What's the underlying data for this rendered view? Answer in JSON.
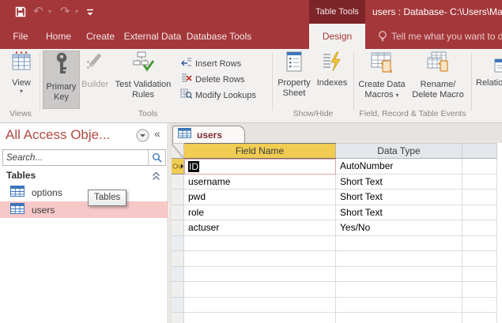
{
  "colors": {
    "accent": "#A4373A",
    "context_tab_bg": "#7D2429",
    "ribbon_bg": "#F3F1F0",
    "selected_column_header": "#F0CD52",
    "nav_selected_item": "#F6C8C8"
  },
  "titlebar": {
    "context_group": "Table Tools",
    "title": "users : Database- C:\\Users\\Mat"
  },
  "menu": {
    "tabs": [
      {
        "label": "File"
      },
      {
        "label": "Home"
      },
      {
        "label": "Create"
      },
      {
        "label": "External Data"
      },
      {
        "label": "Database Tools"
      },
      {
        "label": "Design"
      }
    ],
    "tell_me": "Tell me what you want to d"
  },
  "ribbon": {
    "views": {
      "label": "Views",
      "view": "View"
    },
    "tools": {
      "label": "Tools",
      "primary_key": "Primary Key",
      "builder": "Builder",
      "test_validation": "Test Validation Rules",
      "insert_rows": "Insert Rows",
      "delete_rows": "Delete Rows",
      "modify_lookups": "Modify Lookups"
    },
    "show_hide": {
      "label": "Show/Hide",
      "property_sheet": "Property Sheet",
      "indexes": "Indexes"
    },
    "events": {
      "label": "Field, Record & Table Events",
      "create_data_macros": "Create Data Macros",
      "rename_delete_macro": "Rename/ Delete Macro"
    },
    "relationships": {
      "label": "Relationships"
    }
  },
  "nav": {
    "title": "All Access Obje...",
    "search_placeholder": "Search...",
    "group_header": "Tables",
    "items": [
      {
        "label": "options"
      },
      {
        "label": "users"
      }
    ],
    "tooltip": "Tables"
  },
  "document": {
    "tab_label": "users",
    "grid": {
      "field_name_header": "Field Name",
      "data_type_header": "Data Type",
      "fields": [
        {
          "name": "ID",
          "type": "AutoNumber"
        },
        {
          "name": "username",
          "type": "Short Text"
        },
        {
          "name": "pwd",
          "type": "Short Text"
        },
        {
          "name": "role",
          "type": "Short Text"
        },
        {
          "name": "actuser",
          "type": "Yes/No"
        }
      ]
    }
  }
}
